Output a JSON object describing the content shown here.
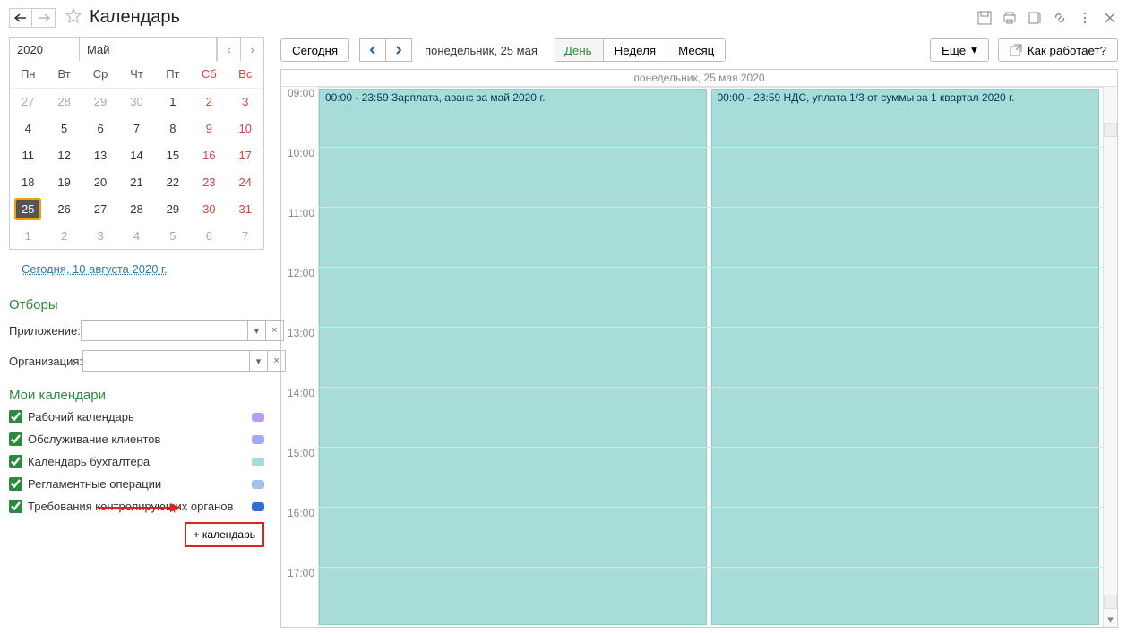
{
  "title": "Календарь",
  "miniCal": {
    "year": "2020",
    "month": "Май",
    "dow": [
      "Пн",
      "Вт",
      "Ср",
      "Чт",
      "Пт",
      "Сб",
      "Вс"
    ],
    "rows": [
      [
        {
          "d": "27",
          "adj": true
        },
        {
          "d": "28",
          "adj": true
        },
        {
          "d": "29",
          "adj": true
        },
        {
          "d": "30",
          "adj": true
        },
        {
          "d": "1"
        },
        {
          "d": "2",
          "wknd": true
        },
        {
          "d": "3",
          "wknd": true
        }
      ],
      [
        {
          "d": "4"
        },
        {
          "d": "5"
        },
        {
          "d": "6"
        },
        {
          "d": "7"
        },
        {
          "d": "8"
        },
        {
          "d": "9",
          "wknd": true
        },
        {
          "d": "10",
          "wknd": true
        }
      ],
      [
        {
          "d": "11"
        },
        {
          "d": "12"
        },
        {
          "d": "13"
        },
        {
          "d": "14"
        },
        {
          "d": "15"
        },
        {
          "d": "16",
          "wknd": true
        },
        {
          "d": "17",
          "wknd": true
        }
      ],
      [
        {
          "d": "18"
        },
        {
          "d": "19"
        },
        {
          "d": "20"
        },
        {
          "d": "21"
        },
        {
          "d": "22"
        },
        {
          "d": "23",
          "wknd": true
        },
        {
          "d": "24",
          "wknd": true
        }
      ],
      [
        {
          "d": "25",
          "sel": true
        },
        {
          "d": "26"
        },
        {
          "d": "27"
        },
        {
          "d": "28"
        },
        {
          "d": "29"
        },
        {
          "d": "30",
          "wknd": true
        },
        {
          "d": "31",
          "wknd": true
        }
      ],
      [
        {
          "d": "1",
          "adj": true
        },
        {
          "d": "2",
          "adj": true
        },
        {
          "d": "3",
          "adj": true
        },
        {
          "d": "4",
          "adj": true
        },
        {
          "d": "5",
          "adj": true
        },
        {
          "d": "6",
          "adj": true
        },
        {
          "d": "7",
          "adj": true
        }
      ]
    ]
  },
  "todayLink": "Сегодня, 10 августа 2020 г.",
  "filters": {
    "title": "Отборы",
    "appLabel": "Приложение:",
    "orgLabel": "Организация:"
  },
  "myCals": {
    "title": "Мои календари",
    "items": [
      {
        "name": "Рабочий календарь",
        "color": "#b89bff"
      },
      {
        "name": "Обслуживание клиентов",
        "color": "#a3a8ff"
      },
      {
        "name": "Календарь бухгалтера",
        "color": "#a7dcd9"
      },
      {
        "name": "Регламентные операции",
        "color": "#9fc3e6"
      },
      {
        "name": "Требования контролирующих органов",
        "color": "#2f6fd6"
      }
    ],
    "addLabel": "+ календарь"
  },
  "toolbar": {
    "today": "Сегодня",
    "dateText": "понедельник, 25 мая",
    "viewDay": "День",
    "viewWeek": "Неделя",
    "viewMonth": "Месяц",
    "more": "Еще",
    "help": "Как работает?"
  },
  "dayHeader": "понедельник, 25 мая 2020",
  "hours": [
    "09:00",
    "10:00",
    "11:00",
    "12:00",
    "13:00",
    "14:00",
    "15:00",
    "16:00",
    "17:00"
  ],
  "events": {
    "e1": "00:00 - 23:59 Зарплата, аванс за май 2020 г.",
    "e2": "00:00 - 23:59 НДС, уплата 1/3 от суммы за 1 квартал 2020 г."
  }
}
